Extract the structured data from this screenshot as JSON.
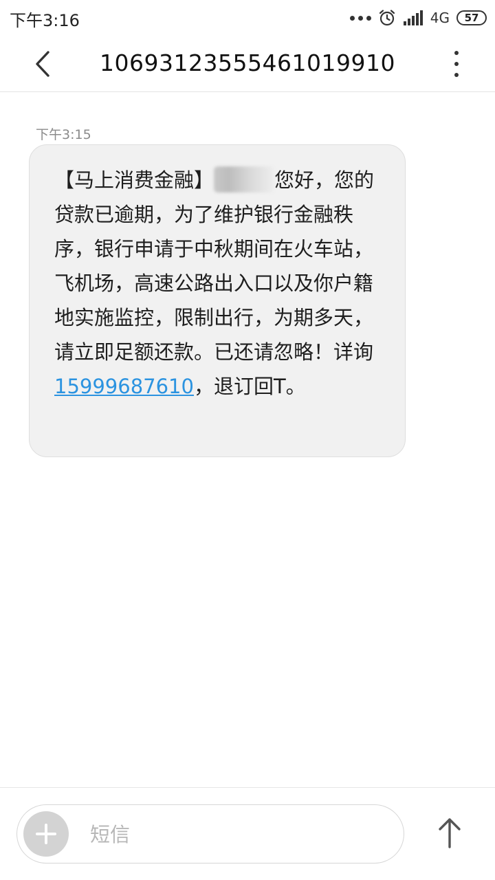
{
  "status_bar": {
    "time": "下午3:16",
    "network": "4G",
    "battery": "57"
  },
  "header": {
    "title": "10693123555461019910"
  },
  "message": {
    "time": "下午3:15",
    "line1_pre": "【马上消费金融】",
    "line1_post": "您好，您",
    "body": "的贷款已逾期，为了维护银行金融秩序，银行申请于中秋期间在火车站，飞机场，高速公路出入口以及你户籍地实施监控，限制出行，为期多天，请立即足额还款。已还请忽略！详询",
    "phone_link": "15999687610",
    "tail": "，退订回T。"
  },
  "composer": {
    "placeholder": "短信"
  },
  "colors": {
    "link": "#2b93e0",
    "bubble": "#f1f1f1"
  }
}
